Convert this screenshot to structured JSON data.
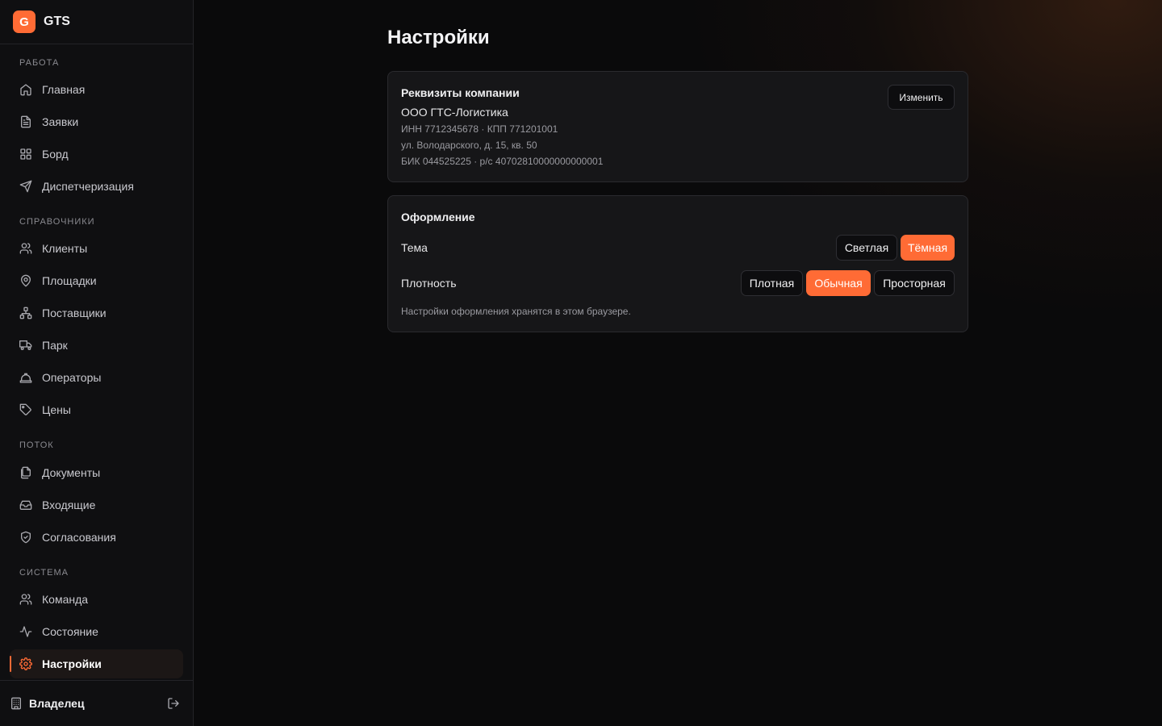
{
  "brand": {
    "logo_letter": "G",
    "name": "GTS",
    "accent_color": "#ff6b35"
  },
  "sidebar": {
    "sections": [
      {
        "label": "РАБОТА",
        "items": [
          {
            "label": "Главная",
            "icon": "home-icon"
          },
          {
            "label": "Заявки",
            "icon": "file-text-icon"
          },
          {
            "label": "Борд",
            "icon": "grid-icon"
          },
          {
            "label": "Диспетчеризация",
            "icon": "send-icon"
          }
        ]
      },
      {
        "label": "СПРАВОЧНИКИ",
        "items": [
          {
            "label": "Клиенты",
            "icon": "users-icon"
          },
          {
            "label": "Площадки",
            "icon": "map-pin-icon"
          },
          {
            "label": "Поставщики",
            "icon": "network-icon"
          },
          {
            "label": "Парк",
            "icon": "truck-icon"
          },
          {
            "label": "Операторы",
            "icon": "hard-hat-icon"
          },
          {
            "label": "Цены",
            "icon": "tag-icon"
          }
        ]
      },
      {
        "label": "ПОТОК",
        "items": [
          {
            "label": "Документы",
            "icon": "files-icon"
          },
          {
            "label": "Входящие",
            "icon": "inbox-icon"
          },
          {
            "label": "Согласования",
            "icon": "shield-check-icon"
          }
        ]
      },
      {
        "label": "СИСТЕМА",
        "items": [
          {
            "label": "Команда",
            "icon": "users-icon"
          },
          {
            "label": "Состояние",
            "icon": "activity-icon"
          },
          {
            "label": "Настройки",
            "icon": "gear-icon",
            "active": true
          }
        ]
      }
    ],
    "footer": {
      "user_label": "Владелец",
      "icon": "building-icon",
      "logout_icon": "logout-icon"
    }
  },
  "page": {
    "title": "Настройки"
  },
  "company": {
    "title": "Реквизиты компании",
    "name": "ООО ГТС-Логистика",
    "inn_kpp": "ИНН 7712345678 · КПП 771201001",
    "address": "ул. Володарского, д. 15, кв. 50",
    "bank": "БИК 044525225 · р/с 40702810000000000001",
    "edit_label": "Изменить"
  },
  "appearance": {
    "title": "Оформление",
    "theme": {
      "label": "Тема",
      "options": [
        "Светлая",
        "Тёмная"
      ],
      "selected": "Тёмная"
    },
    "density": {
      "label": "Плотность",
      "options": [
        "Плотная",
        "Обычная",
        "Просторная"
      ],
      "selected": "Обычная"
    },
    "hint": "Настройки оформления хранятся в этом браузере."
  }
}
